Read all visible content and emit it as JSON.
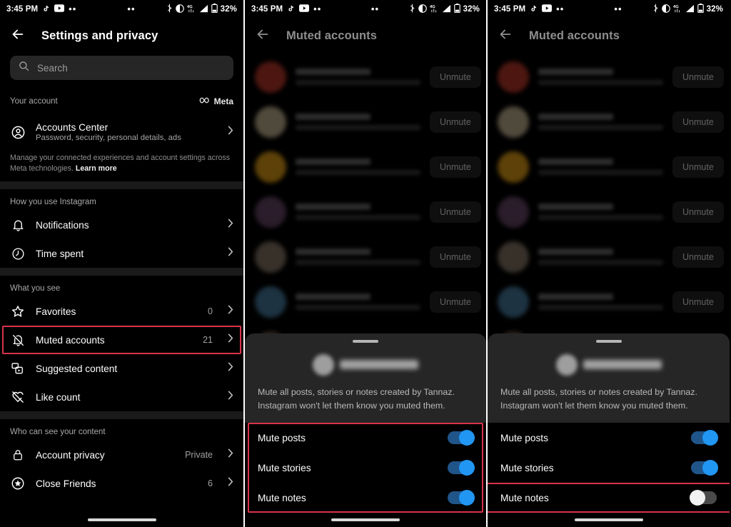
{
  "colors": {
    "accent_blue": "#2196f3",
    "switch_track_on": "#20558a",
    "switch_track_off": "#4a4a4a",
    "highlight_red": "#d9334a",
    "background": "#000000",
    "sheet_background": "#262626"
  },
  "status_bar": {
    "time": "3:45 PM",
    "left_icons": [
      "tiktok-icon",
      "youtube-icon",
      "more-dots-icon"
    ],
    "center_icons": [
      "more-dots-icon"
    ],
    "right_icons": [
      "bluetooth-icon",
      "do-not-disturb-icon",
      "4g-signal-icon",
      "cellular-signal-icon",
      "battery-icon"
    ],
    "battery": "32%",
    "network": "4G"
  },
  "panel1": {
    "header": {
      "back_icon": "back-arrow-icon",
      "title": "Settings and privacy"
    },
    "search": {
      "icon": "search-icon",
      "placeholder": "Search",
      "value": ""
    },
    "sections": [
      {
        "label": "Your account",
        "badge": "Meta",
        "badge_icon": "meta-infinity-icon",
        "items": [
          {
            "icon": "account-circle-icon",
            "label": "Accounts Center",
            "subtitle": "Password, security, personal details, ads",
            "value": "",
            "chevron": true,
            "highlighted": false
          }
        ],
        "description": "Manage your connected experiences and account settings across Meta technologies.",
        "description_link": "Learn more"
      },
      {
        "label": "How you use Instagram",
        "items": [
          {
            "icon": "bell-icon",
            "label": "Notifications",
            "value": "",
            "chevron": true,
            "highlighted": false
          },
          {
            "icon": "clock-icon",
            "label": "Time spent",
            "value": "",
            "chevron": true,
            "highlighted": false
          }
        ]
      },
      {
        "label": "What you see",
        "items": [
          {
            "icon": "star-icon",
            "label": "Favorites",
            "value": "0",
            "chevron": true,
            "highlighted": false
          },
          {
            "icon": "bell-slash-icon",
            "label": "Muted accounts",
            "value": "21",
            "chevron": true,
            "highlighted": true
          },
          {
            "icon": "suggested-content-icon",
            "label": "Suggested content",
            "value": "",
            "chevron": true,
            "highlighted": false
          },
          {
            "icon": "heart-slash-icon",
            "label": "Like count",
            "value": "",
            "chevron": true,
            "highlighted": false
          }
        ]
      },
      {
        "label": "Who can see your content",
        "items": [
          {
            "icon": "lock-icon",
            "label": "Account privacy",
            "value": "Private",
            "chevron": true,
            "highlighted": false
          },
          {
            "icon": "star-circle-icon",
            "label": "Close Friends",
            "value": "6",
            "chevron": true,
            "highlighted": false
          }
        ]
      }
    ]
  },
  "panel2": {
    "header": {
      "back_icon": "back-arrow-icon",
      "title": "Muted accounts"
    },
    "dimmed": true,
    "muted_accounts": [
      {
        "avatar_color": "#c0392b",
        "unmute_label": "Unmute"
      },
      {
        "avatar_color": "#c9b896",
        "unmute_label": "Unmute"
      },
      {
        "avatar_color": "#e8a317",
        "unmute_label": "Unmute"
      },
      {
        "avatar_color": "#6b4a6b",
        "unmute_label": "Unmute"
      },
      {
        "avatar_color": "#8a7a6a",
        "unmute_label": "Unmute"
      },
      {
        "avatar_color": "#4a7fa5",
        "unmute_label": "Unmute"
      },
      {
        "avatar_color": "#7a5a4a",
        "unmute_label": "Unmute"
      }
    ],
    "sheet": {
      "grabber": "sheet-grabber",
      "description": "Mute all posts, stories or notes created by Tannaz. Instagram won't let them know you muted them.",
      "toggles": [
        {
          "label": "Mute posts",
          "state": "on"
        },
        {
          "label": "Mute stories",
          "state": "on"
        },
        {
          "label": "Mute notes",
          "state": "on"
        }
      ],
      "highlight_group": true,
      "highlight_row_index": -1
    }
  },
  "panel3": {
    "header": {
      "back_icon": "back-arrow-icon",
      "title": "Muted accounts"
    },
    "dimmed": true,
    "muted_accounts": [
      {
        "avatar_color": "#c0392b",
        "unmute_label": "Unmute"
      },
      {
        "avatar_color": "#c9b896",
        "unmute_label": "Unmute"
      },
      {
        "avatar_color": "#e8a317",
        "unmute_label": "Unmute"
      },
      {
        "avatar_color": "#6b4a6b",
        "unmute_label": "Unmute"
      },
      {
        "avatar_color": "#8a7a6a",
        "unmute_label": "Unmute"
      },
      {
        "avatar_color": "#4a7fa5",
        "unmute_label": "Unmute"
      },
      {
        "avatar_color": "#7a5a4a",
        "unmute_label": "Unmute"
      }
    ],
    "sheet": {
      "grabber": "sheet-grabber",
      "description": "Mute all posts, stories or notes created by Tannaz. Instagram won't let them know you muted them.",
      "toggles": [
        {
          "label": "Mute posts",
          "state": "on"
        },
        {
          "label": "Mute stories",
          "state": "on"
        },
        {
          "label": "Mute notes",
          "state": "off"
        }
      ],
      "highlight_group": false,
      "highlight_row_index": 2
    }
  }
}
